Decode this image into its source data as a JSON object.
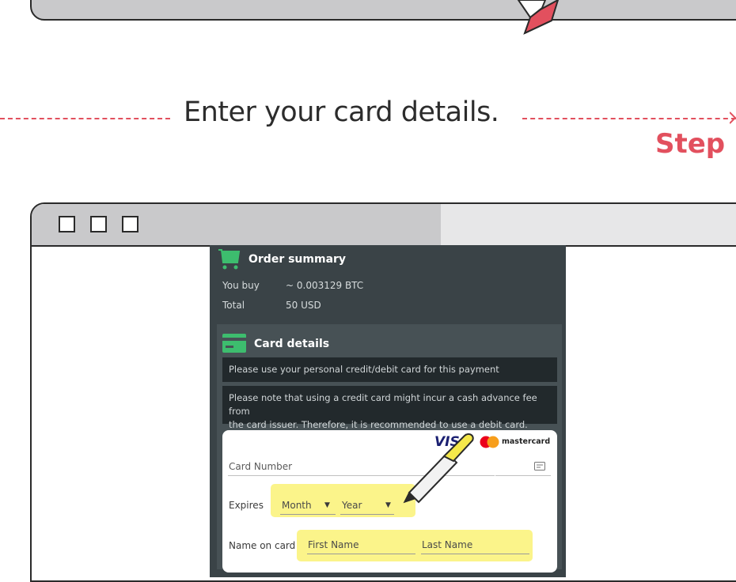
{
  "heading": "Enter your card details.",
  "step_label": "Step",
  "order": {
    "title": "Order summary",
    "rows": [
      {
        "label": "You buy",
        "value": "~ 0.003129 BTC"
      },
      {
        "label": "Total",
        "value": "50 USD"
      }
    ]
  },
  "card": {
    "title": "Card details",
    "notice1": "Please use your personal credit/debit card for this payment",
    "notice2_line1": "Please note that using a credit card might incur a cash advance fee from",
    "notice2_line2": "the card issuer. Therefore, it is recommended to use a debit card.",
    "visa": "VISA",
    "mastercard": "mastercard",
    "card_number_placeholder": "Card Number",
    "expires_label": "Expires",
    "month": "Month",
    "year": "Year",
    "name_label": "Name on card",
    "first_name": "First Name",
    "last_name": "Last Name"
  },
  "colors": {
    "accent": "#e2505e",
    "cart_green": "#3dbd6e",
    "panel": "#3a4347",
    "highlight": "#fbf48a"
  }
}
